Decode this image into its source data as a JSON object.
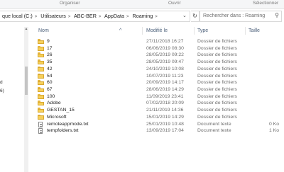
{
  "ribbon": {
    "organiser": "Organiser",
    "ouvrir": "Ouvrir",
    "selectionner": "Sélectionner"
  },
  "address": {
    "crumbs": [
      "que local (C:)",
      "Utilisateurs",
      "ABC-BER",
      "AppData",
      "Roaming"
    ]
  },
  "search": {
    "placeholder": "Rechercher dans : Roaming"
  },
  "nav": {
    "frag1": "d",
    "frag2": "6)"
  },
  "columns": {
    "name": "Nom",
    "modified": "Modifié le",
    "type": "Type",
    "size": "Taille"
  },
  "files": [
    {
      "name": "9",
      "date": "27/11/2018 16:27",
      "type": "Dossier de fichiers",
      "size": "",
      "kind": "folder"
    },
    {
      "name": "17",
      "date": "06/06/2019 08:30",
      "type": "Dossier de fichiers",
      "size": "",
      "kind": "folder"
    },
    {
      "name": "26",
      "date": "28/05/2019 09:22",
      "type": "Dossier de fichiers",
      "size": "",
      "kind": "folder"
    },
    {
      "name": "35",
      "date": "28/05/2019 09:47",
      "type": "Dossier de fichiers",
      "size": "",
      "kind": "folder"
    },
    {
      "name": "42",
      "date": "24/10/2019 10:08",
      "type": "Dossier de fichiers",
      "size": "",
      "kind": "folder"
    },
    {
      "name": "54",
      "date": "10/07/2019 11:23",
      "type": "Dossier de fichiers",
      "size": "",
      "kind": "folder"
    },
    {
      "name": "60",
      "date": "20/09/2019 14:17",
      "type": "Dossier de fichiers",
      "size": "",
      "kind": "folder"
    },
    {
      "name": "67",
      "date": "28/06/2019 14:29",
      "type": "Dossier de fichiers",
      "size": "",
      "kind": "folder"
    },
    {
      "name": "100",
      "date": "11/09/2019 23:41",
      "type": "Dossier de fichiers",
      "size": "",
      "kind": "folder"
    },
    {
      "name": "Adobe",
      "date": "07/02/2018 20:09",
      "type": "Dossier de fichiers",
      "size": "",
      "kind": "folder"
    },
    {
      "name": "GESTAN_15",
      "date": "21/11/2019 14:36",
      "type": "Dossier de fichiers",
      "size": "",
      "kind": "folder"
    },
    {
      "name": "Microsoft",
      "date": "15/01/2019 14:29",
      "type": "Dossier de fichiers",
      "size": "",
      "kind": "folder"
    },
    {
      "name": "remoteappmode.txt",
      "date": "25/01/2019 10:48",
      "type": "Document texte",
      "size": "0 Ko",
      "kind": "doc"
    },
    {
      "name": "tempfolders.txt",
      "date": "13/09/2019 17:04",
      "type": "Document texte",
      "size": "1 Ko",
      "kind": "doc"
    }
  ]
}
